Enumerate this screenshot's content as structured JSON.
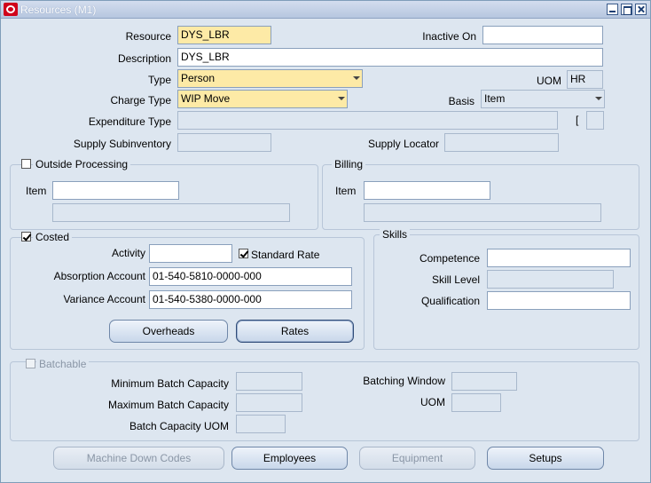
{
  "window": {
    "title": "Resources (M1)"
  },
  "labels": {
    "resource": "Resource",
    "inactive_on": "Inactive On",
    "description": "Description",
    "type": "Type",
    "uom": "UOM",
    "charge_type": "Charge Type",
    "basis": "Basis",
    "expenditure_type": "Expenditure Type",
    "bracket": "[",
    "supply_subinventory": "Supply Subinventory",
    "supply_locator": "Supply Locator"
  },
  "values": {
    "resource": "DYS_LBR",
    "inactive_on": "",
    "description": "DYS_LBR",
    "type": "Person",
    "uom": "HR",
    "charge_type": "WIP Move",
    "basis": "Item",
    "expenditure_type": "",
    "supply_subinventory": "",
    "supply_locator": ""
  },
  "outside_processing": {
    "title": "Outside Processing",
    "checked": false,
    "item_label": "Item",
    "item_value": "",
    "item_desc": ""
  },
  "billing": {
    "title": "Billing",
    "item_label": "Item",
    "item_value": "",
    "item_desc": ""
  },
  "costed": {
    "title": "Costed",
    "checked": true,
    "activity_label": "Activity",
    "activity_value": "",
    "standard_rate_label": "Standard Rate",
    "standard_rate_checked": true,
    "absorption_label": "Absorption Account",
    "absorption_value": "01-540-5810-0000-000",
    "variance_label": "Variance Account",
    "variance_value": "01-540-5380-0000-000",
    "overheads_button": "Overheads",
    "rates_button": "Rates"
  },
  "skills": {
    "title": "Skills",
    "competence_label": "Competence",
    "skill_level_label": "Skill Level",
    "qualification_label": "Qualification"
  },
  "batchable": {
    "title": "Batchable",
    "checked": false,
    "min_label": "Minimum Batch Capacity",
    "max_label": "Maximum Batch Capacity",
    "uom_cap_label": "Batch Capacity UOM",
    "window_label": "Batching Window",
    "uom_label": "UOM"
  },
  "footer": {
    "machine_down": "Machine Down Codes",
    "employees": "Employees",
    "equipment": "Equipment",
    "setups": "Setups"
  }
}
